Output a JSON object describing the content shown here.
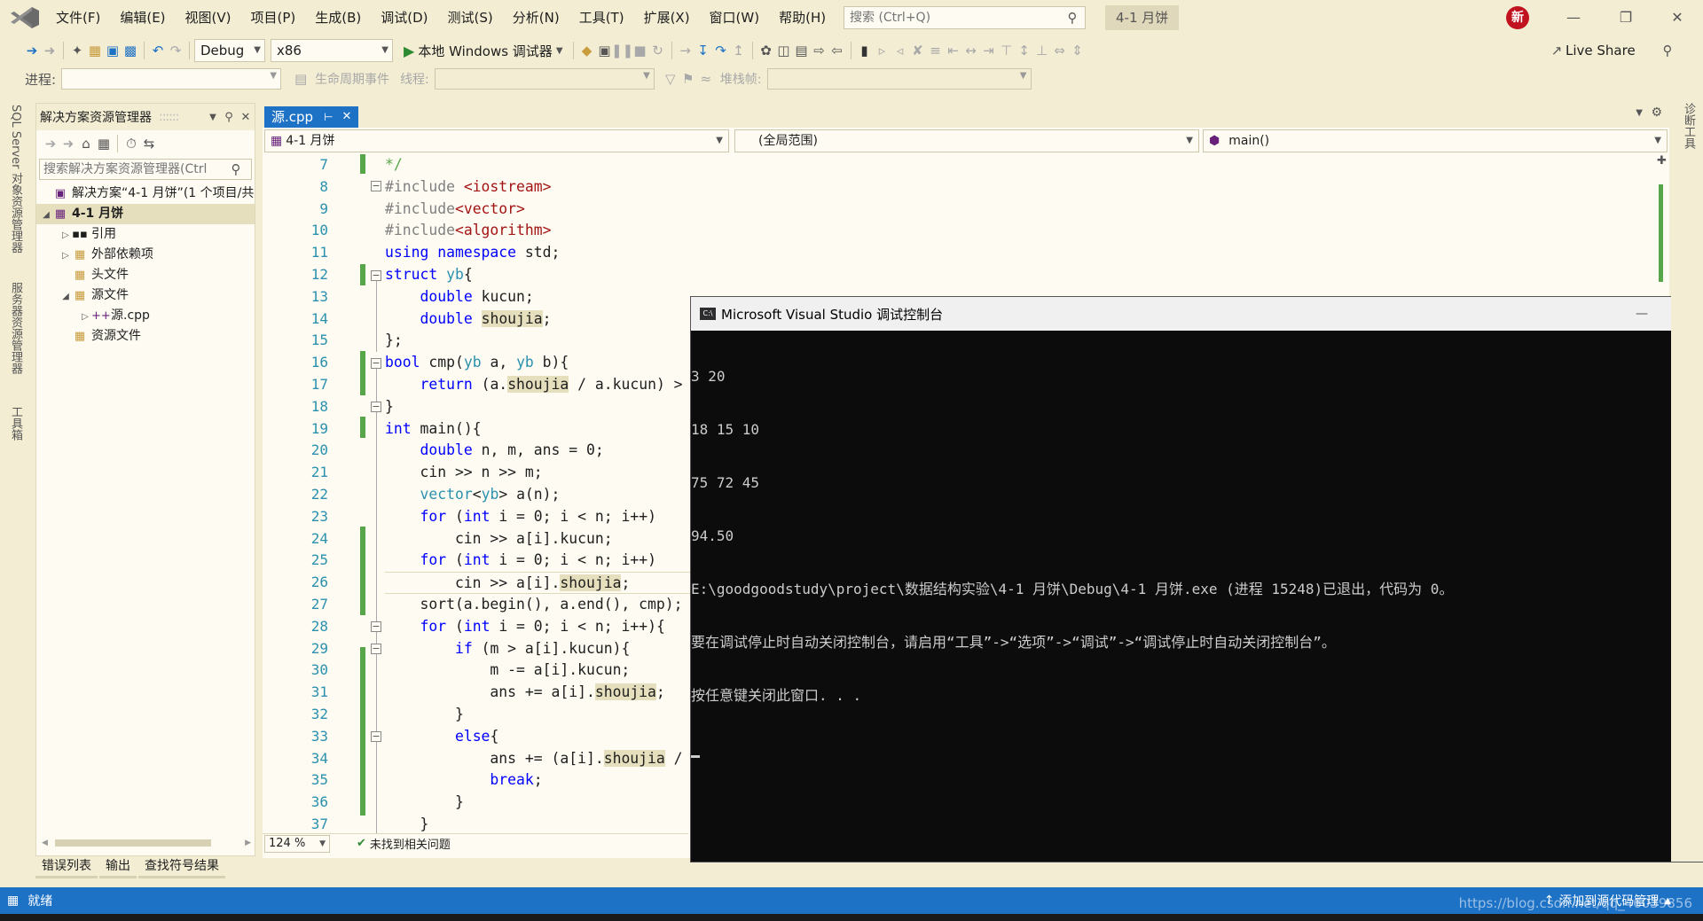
{
  "titlebar": {
    "menu": [
      "文件(F)",
      "编辑(E)",
      "视图(V)",
      "项目(P)",
      "生成(B)",
      "调试(D)",
      "测试(S)",
      "分析(N)",
      "工具(T)",
      "扩展(X)",
      "窗口(W)",
      "帮助(H)"
    ],
    "search_placeholder": "搜索 (Ctrl+Q)",
    "project_title": "4-1 月饼",
    "avatar_text": "新"
  },
  "toolbar": {
    "config": "Debug",
    "platform": "x86",
    "run_label": "本地 Windows 调试器",
    "live_share": "Live Share"
  },
  "debugbar": {
    "process_label": "进程:",
    "lifecycle_label": "生命周期事件",
    "thread_label": "线程:",
    "stackframe_label": "堆栈帧:"
  },
  "leftstrip": {
    "tabs": [
      "SQL Server 对象资源管理器",
      "服务器资源管理器",
      "工具箱"
    ]
  },
  "solution": {
    "title": "解决方案资源管理器",
    "search_placeholder": "搜索解决方案资源管理器(Ctrl",
    "items": [
      {
        "label": "解决方案“4-1 月饼”(1 个项目/共"
      },
      {
        "label": "4-1 月饼"
      },
      {
        "label": "引用"
      },
      {
        "label": "外部依赖项"
      },
      {
        "label": "头文件"
      },
      {
        "label": "源文件"
      },
      {
        "label": "源.cpp"
      },
      {
        "label": "资源文件"
      }
    ]
  },
  "bottom_tabs": [
    "错误列表",
    "输出",
    "查找符号结果"
  ],
  "editor": {
    "tab_name": "源.cpp",
    "nav_project": "4-1 月饼",
    "nav_scope": "(全局范围)",
    "nav_member": "main()",
    "line_numbers": [
      "7",
      "8",
      "9",
      "10",
      "11",
      "12",
      "13",
      "14",
      "15",
      "16",
      "17",
      "18",
      "19",
      "20",
      "21",
      "22",
      "23",
      "24",
      "25",
      "26",
      "27",
      "28",
      "29",
      "30",
      "31",
      "32",
      "33",
      "34",
      "35",
      "36",
      "37"
    ],
    "zoom": "124 %",
    "issues": "未找到相关问题"
  },
  "console": {
    "title": "Microsoft Visual Studio 调试控制台",
    "lines": [
      "3 20",
      "18 15 10",
      "75 72 45",
      "94.50",
      "E:\\goodgoodstudy\\project\\数据结构实验\\4-1 月饼\\Debug\\4-1 月饼.exe (进程 15248)已退出，代码为 0。",
      "要在调试停止时自动关闭控制台，请启用“工具”->“选项”->“调试”->“调试停止时自动关闭控制台”。",
      "按任意键关闭此窗口. . ."
    ]
  },
  "rightstrip": {
    "tabs": [
      "诊断工具"
    ]
  },
  "statusbar": {
    "ready": "就绪",
    "source_control": "添加到源代码管理",
    "watermark": "https://blog.csdn.net/qq_46039856"
  },
  "colors": {
    "accent": "#1e72c6",
    "background": "#f3edd3",
    "console_bg": "#0c0c0c"
  }
}
